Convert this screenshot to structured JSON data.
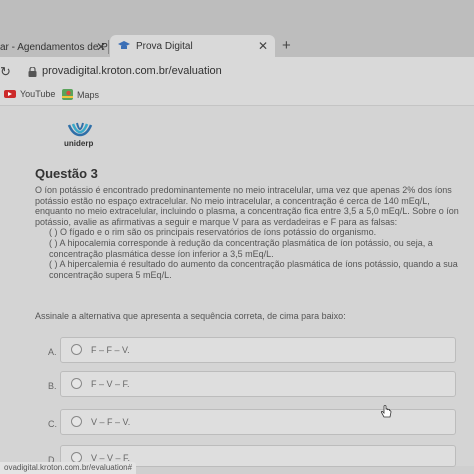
{
  "browser": {
    "tabs": [
      {
        "label": "ar - Agendamentos de P"
      },
      {
        "label": "Prova Digital"
      }
    ],
    "new_tab_label": "+",
    "close_glyph": "✕",
    "reload_glyph": "↻",
    "url": "provadigital.kroton.com.br/evaluation",
    "bookmarks": [
      {
        "label": "YouTube",
        "icon": "youtube-icon"
      },
      {
        "label": "Maps",
        "icon": "maps-icon"
      }
    ],
    "status_url": "ovadigital.kroton.com.br/evaluation#"
  },
  "page": {
    "logo_text": "uniderp",
    "question_title": "Questão 3",
    "question_lines": [
      "O íon potássio é encontrado predominantemente no meio intracelular, uma vez que apenas 2% dos íons",
      "potássio estão no espaço extracelular. No meio intracelular, a concentração é cerca de 140 mEq/L,",
      "enquanto no meio extracelular, incluindo o plasma, a concentração fica entre 3,5 a 5,0 mEq/L. Sobre o íon",
      "potássio, avalie as afirmativas a seguir e marque V para as verdadeiras e F para as falsas:"
    ],
    "statements": [
      "( ) O fígado e o rim são os principais reservatórios de íons potássio do organismo.",
      "( ) A hipocalemia corresponde à redução da concentração plasmática de íon potássio, ou seja, a",
      "concentração plasmática desse íon inferior a 3,5 mEq/L.",
      "( ) A hipercalemia é resultado do aumento da concentração plasmática de íons potássio, quando a sua",
      "concentração supera 5 mEq/L."
    ],
    "instruction": "Assinale a alternativa que apresenta a sequência correta, de cima para baixo:",
    "options": [
      {
        "letter": "A.",
        "text": "F – F – V."
      },
      {
        "letter": "B.",
        "text": "F – V – F."
      },
      {
        "letter": "C.",
        "text": "V – F – V."
      },
      {
        "letter": "D.",
        "text": "V – V – F."
      }
    ]
  },
  "colors": {
    "youtube": "#cc2a2a",
    "logo_blue": "#2f6fa8",
    "logo_teal": "#3aa9c9"
  }
}
